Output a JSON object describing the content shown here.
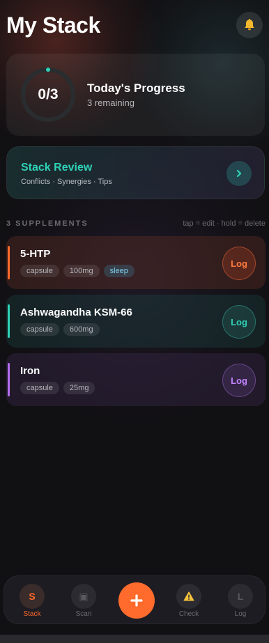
{
  "header": {
    "title": "My Stack",
    "bell_icon": "bell-icon"
  },
  "progress": {
    "value_text": "0/3",
    "fraction": 0.0,
    "title": "Today's Progress",
    "subtitle": "3 remaining"
  },
  "review": {
    "title": "Stack Review",
    "subtitle": "Conflicts · Synergies · Tips",
    "arrow_icon": "chevron-right-icon"
  },
  "section": {
    "count_label": "3 SUPPLEMENTS",
    "hint": "tap = edit · hold = delete"
  },
  "supplements": [
    {
      "name": "5-HTP",
      "tags": [
        "capsule",
        "100mg",
        "sleep"
      ],
      "log_label": "Log",
      "color": "#ff6a2d"
    },
    {
      "name": "Ashwagandha KSM-66",
      "tags": [
        "capsule",
        "600mg"
      ],
      "log_label": "Log",
      "color": "#2ed3b7"
    },
    {
      "name": "Iron",
      "tags": [
        "capsule",
        "25mg"
      ],
      "log_label": "Log",
      "color": "#b66ef0"
    }
  ],
  "tabs": [
    {
      "glyph": "S",
      "label": "Stack",
      "active": true
    },
    {
      "glyph": "▣",
      "label": "Scan",
      "active": false
    },
    {
      "glyph": "⚠",
      "label": "Check",
      "active": false
    },
    {
      "glyph": "L",
      "label": "Log",
      "active": false
    }
  ],
  "add_button": {
    "glyph": "+",
    "icon": "plus-icon"
  },
  "colors": {
    "accent": "#ff6b2c",
    "teal": "#2ed3b7",
    "purple": "#b66ef0",
    "background": "#111013"
  }
}
